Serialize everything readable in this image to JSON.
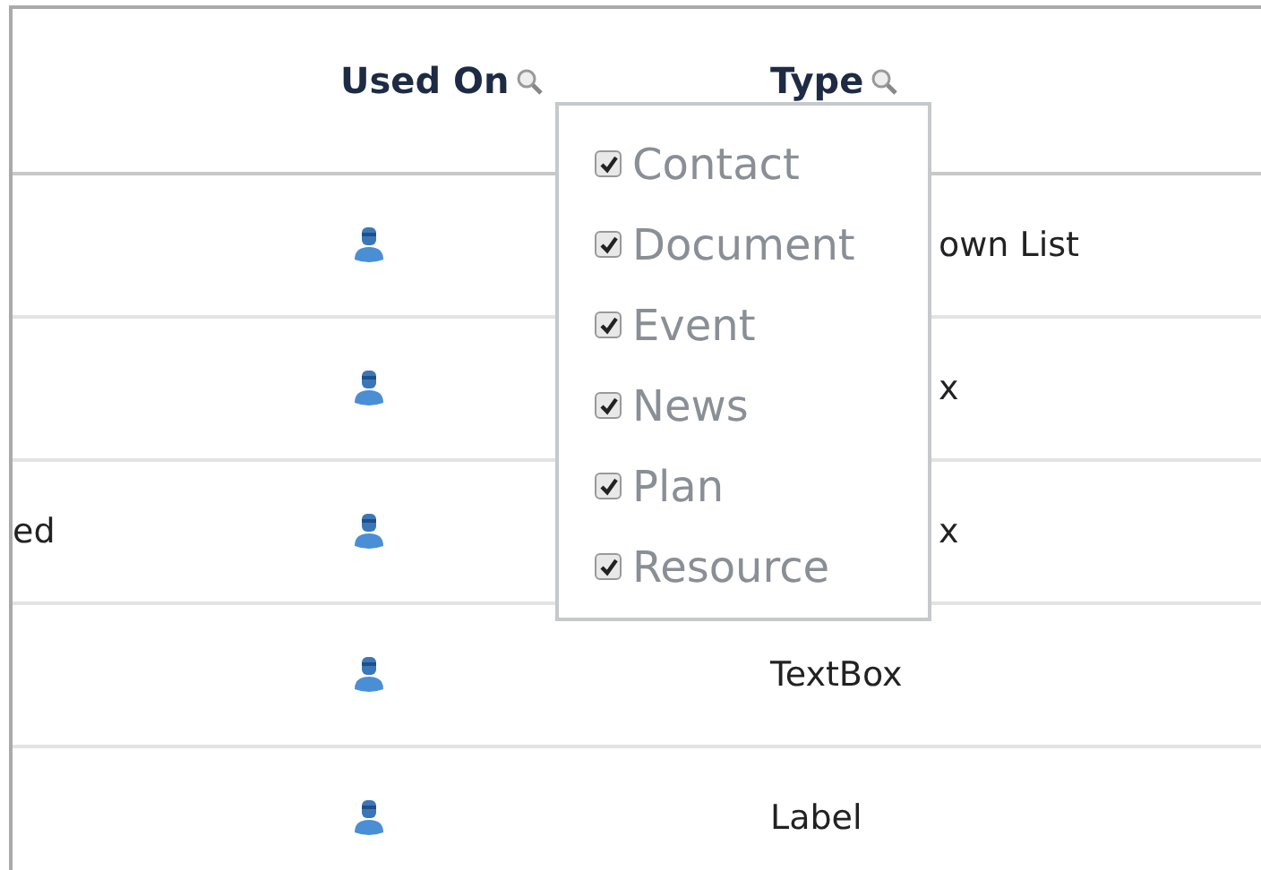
{
  "columns": [
    {
      "label": "Used On"
    },
    {
      "label": "Type"
    }
  ],
  "rows": [
    {
      "name": "",
      "type": "own List"
    },
    {
      "name": "",
      "type": "x"
    },
    {
      "name": "ed",
      "type": "x"
    },
    {
      "name": "",
      "type": "TextBox"
    },
    {
      "name": "",
      "type": "Label"
    }
  ],
  "filter_menu": {
    "options": [
      {
        "label": "Contact",
        "checked": true
      },
      {
        "label": "Document",
        "checked": true
      },
      {
        "label": "Event",
        "checked": true
      },
      {
        "label": "News",
        "checked": true
      },
      {
        "label": "Plan",
        "checked": true
      },
      {
        "label": "Resource",
        "checked": true
      }
    ]
  }
}
